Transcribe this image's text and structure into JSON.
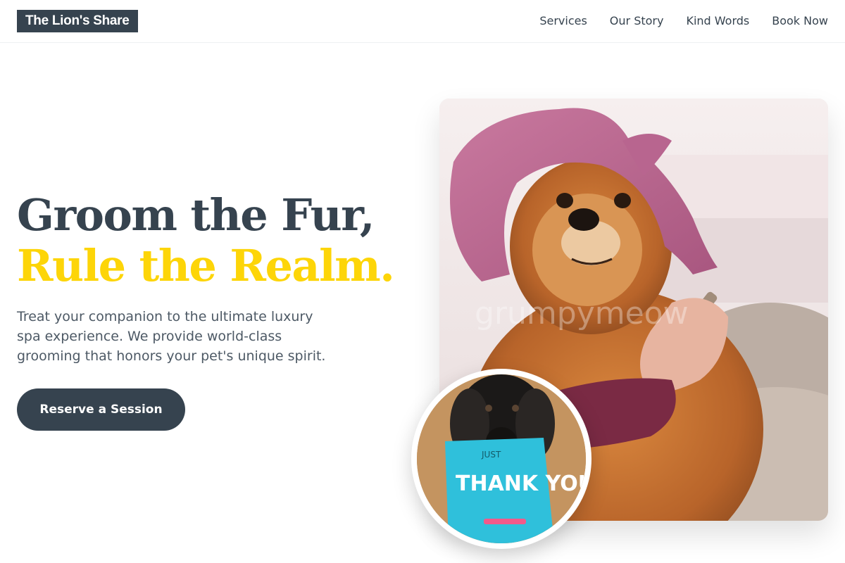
{
  "brand": {
    "name": "The Lion's Share"
  },
  "nav": {
    "items": [
      "Services",
      "Our Story",
      "Kind Words",
      "Book Now"
    ]
  },
  "hero": {
    "title_line1": "Groom the Fur,",
    "title_line2": "Rule the Realm.",
    "description": "Treat your companion to the ultimate luxury spa experience. We provide world-class grooming that honors your pet's unique spirit.",
    "cta_label": "Reserve a Session"
  },
  "images": {
    "main_photo": {
      "watermark": "grumpymeow"
    },
    "badge_photo": {
      "card_text_top": "JUST",
      "card_text_main": "THANK YOU!"
    }
  },
  "colors": {
    "primary": "#36434f",
    "accent": "#fdd508",
    "text_muted": "#4d5965",
    "background": "#ffffff"
  }
}
